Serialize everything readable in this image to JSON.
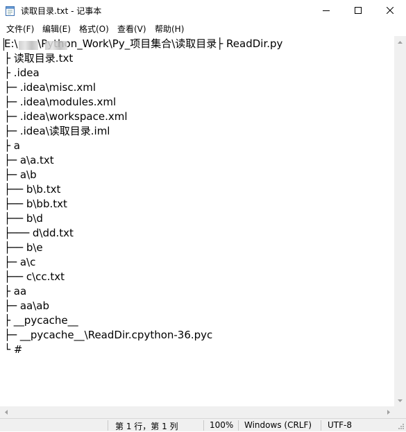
{
  "window": {
    "title": "读取目录.txt - 记事本"
  },
  "menu": [
    {
      "label": "文件(F)"
    },
    {
      "label": "编辑(E)"
    },
    {
      "label": "格式(O)"
    },
    {
      "label": "查看(V)"
    },
    {
      "label": "帮助(H)"
    }
  ],
  "editor": {
    "lines": [
      "E:\\      \\Python_Work\\Py_项目集合\\读取目录├ ReadDir.py",
      "├ 读取目录.txt",
      "├ .idea",
      "├─ .idea\\misc.xml",
      "├─ .idea\\modules.xml",
      "├─ .idea\\workspace.xml",
      "├─ .idea\\读取目录.iml",
      "├ a",
      "├─ a\\a.txt",
      "├─ a\\b",
      "├── b\\b.txt",
      "├── b\\bb.txt",
      "├── b\\d",
      "├─── d\\dd.txt",
      "├── b\\e",
      "├─ a\\c",
      "├── c\\cc.txt",
      "├ aa",
      "├─ aa\\ab",
      "├ __pycache__",
      "├─ __pycache__\\ReadDir.cpython-36.pyc",
      "└ #"
    ]
  },
  "status": {
    "position": "第 1 行，第 1 列",
    "zoom": "100%",
    "line_ending": "Windows (CRLF)",
    "encoding": "UTF-8"
  }
}
